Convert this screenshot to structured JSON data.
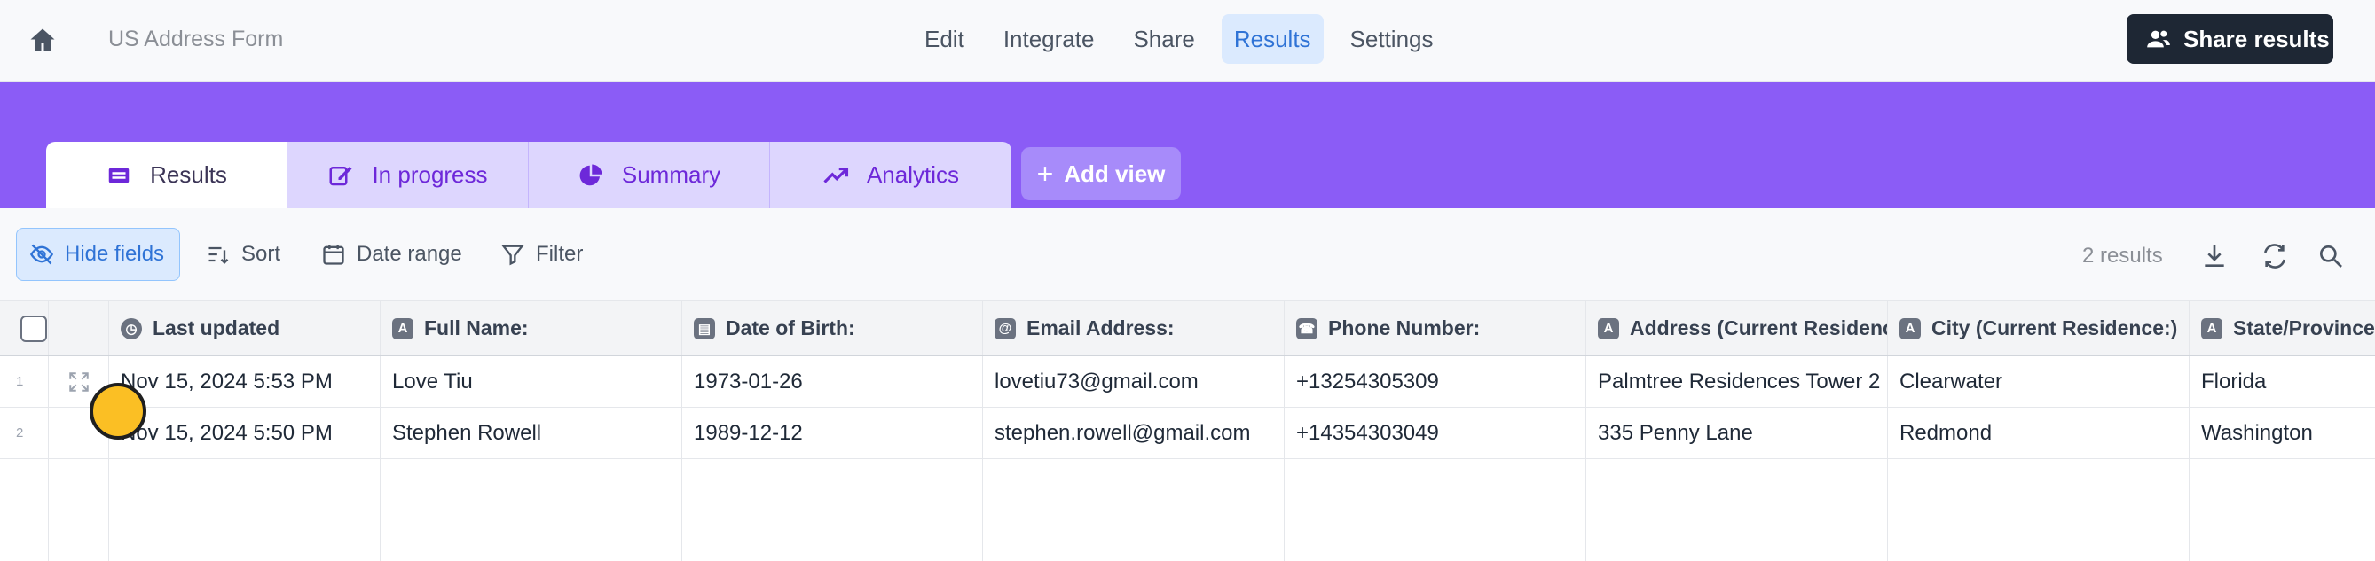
{
  "app": {
    "title": "US Address Form"
  },
  "nav": {
    "items": [
      "Edit",
      "Integrate",
      "Share",
      "Results",
      "Settings"
    ],
    "active": "Results"
  },
  "share_button": {
    "label": "Share results"
  },
  "tabs": [
    {
      "label": "Results",
      "icon": "table-icon"
    },
    {
      "label": "In progress",
      "icon": "edit-icon"
    },
    {
      "label": "Summary",
      "icon": "pie-chart-icon"
    },
    {
      "label": "Analytics",
      "icon": "trend-icon"
    }
  ],
  "add_view": {
    "label": "Add view"
  },
  "toolbar": {
    "hide_fields": "Hide fields",
    "sort": "Sort",
    "date_range": "Date range",
    "filter": "Filter",
    "results_count": "2 results"
  },
  "table": {
    "columns": [
      {
        "label": "Last updated",
        "icon": "clock-icon"
      },
      {
        "label": "Full Name:",
        "icon": "text-icon"
      },
      {
        "label": "Date of Birth:",
        "icon": "calendar-icon"
      },
      {
        "label": "Email Address:",
        "icon": "at-icon"
      },
      {
        "label": "Phone Number:",
        "icon": "phone-icon"
      },
      {
        "label": "Address (Current Residence",
        "icon": "text-icon"
      },
      {
        "label": "City (Current Residence:)",
        "icon": "text-icon"
      },
      {
        "label": "State/Province",
        "icon": "text-icon"
      }
    ],
    "rows": [
      {
        "num": "1",
        "cells": [
          "Nov 15, 2024 5:53 PM",
          "Love Tiu",
          "1973-01-26",
          "lovetiu73@gmail.com",
          "+13254305309",
          "Palmtree Residences Tower 2",
          "Clearwater",
          "Florida"
        ]
      },
      {
        "num": "2",
        "cells": [
          "Nov 15, 2024 5:50 PM",
          "Stephen Rowell",
          "1989-12-12",
          "stephen.rowell@gmail.com",
          "+14354303049",
          "335 Penny Lane",
          "Redmond",
          "Washington"
        ]
      }
    ]
  },
  "colors": {
    "accent": "#8b5cf6",
    "primary_dark": "#1e2734",
    "active_blue": "#2f73d6"
  }
}
